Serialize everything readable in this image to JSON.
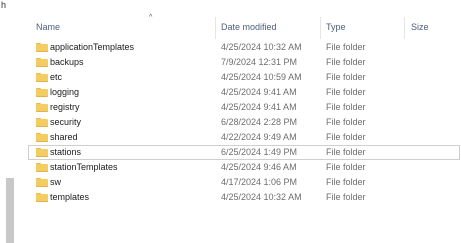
{
  "window": {
    "corner_char": "h"
  },
  "columns": {
    "name": "Name",
    "date_modified": "Date modified",
    "type": "Type",
    "size": "Size",
    "sort_indicator": "^"
  },
  "files": [
    {
      "name": "applicationTemplates",
      "date": "4/25/2024 10:32 AM",
      "type": "File folder",
      "icon": "folder-icon"
    },
    {
      "name": "backups",
      "date": "7/9/2024 12:31 PM",
      "type": "File folder",
      "icon": "folder-icon"
    },
    {
      "name": "etc",
      "date": "4/25/2024 10:59 AM",
      "type": "File folder",
      "icon": "folder-icon"
    },
    {
      "name": "logging",
      "date": "4/25/2024 9:41 AM",
      "type": "File folder",
      "icon": "folder-icon"
    },
    {
      "name": "registry",
      "date": "4/25/2024 9:41 AM",
      "type": "File folder",
      "icon": "folder-icon"
    },
    {
      "name": "security",
      "date": "6/28/2024 2:28 PM",
      "type": "File folder",
      "icon": "folder-icon"
    },
    {
      "name": "shared",
      "date": "4/22/2024 9:49 AM",
      "type": "File folder",
      "icon": "folder-icon"
    },
    {
      "name": "stations",
      "date": "6/25/2024 1:49 PM",
      "type": "File folder",
      "icon": "folder-icon",
      "focused": true
    },
    {
      "name": "stationTemplates",
      "date": "4/25/2024 9:46 AM",
      "type": "File folder",
      "icon": "folder-icon"
    },
    {
      "name": "sw",
      "date": "4/17/2024 1:06 PM",
      "type": "File folder",
      "icon": "folder-icon"
    },
    {
      "name": "templates",
      "date": "4/25/2024 10:32 AM",
      "type": "File folder",
      "icon": "folder-icon"
    }
  ],
  "colors": {
    "header_text": "#4c607a",
    "folder": "#f3cd62",
    "detail_text": "#6d6d6d"
  }
}
